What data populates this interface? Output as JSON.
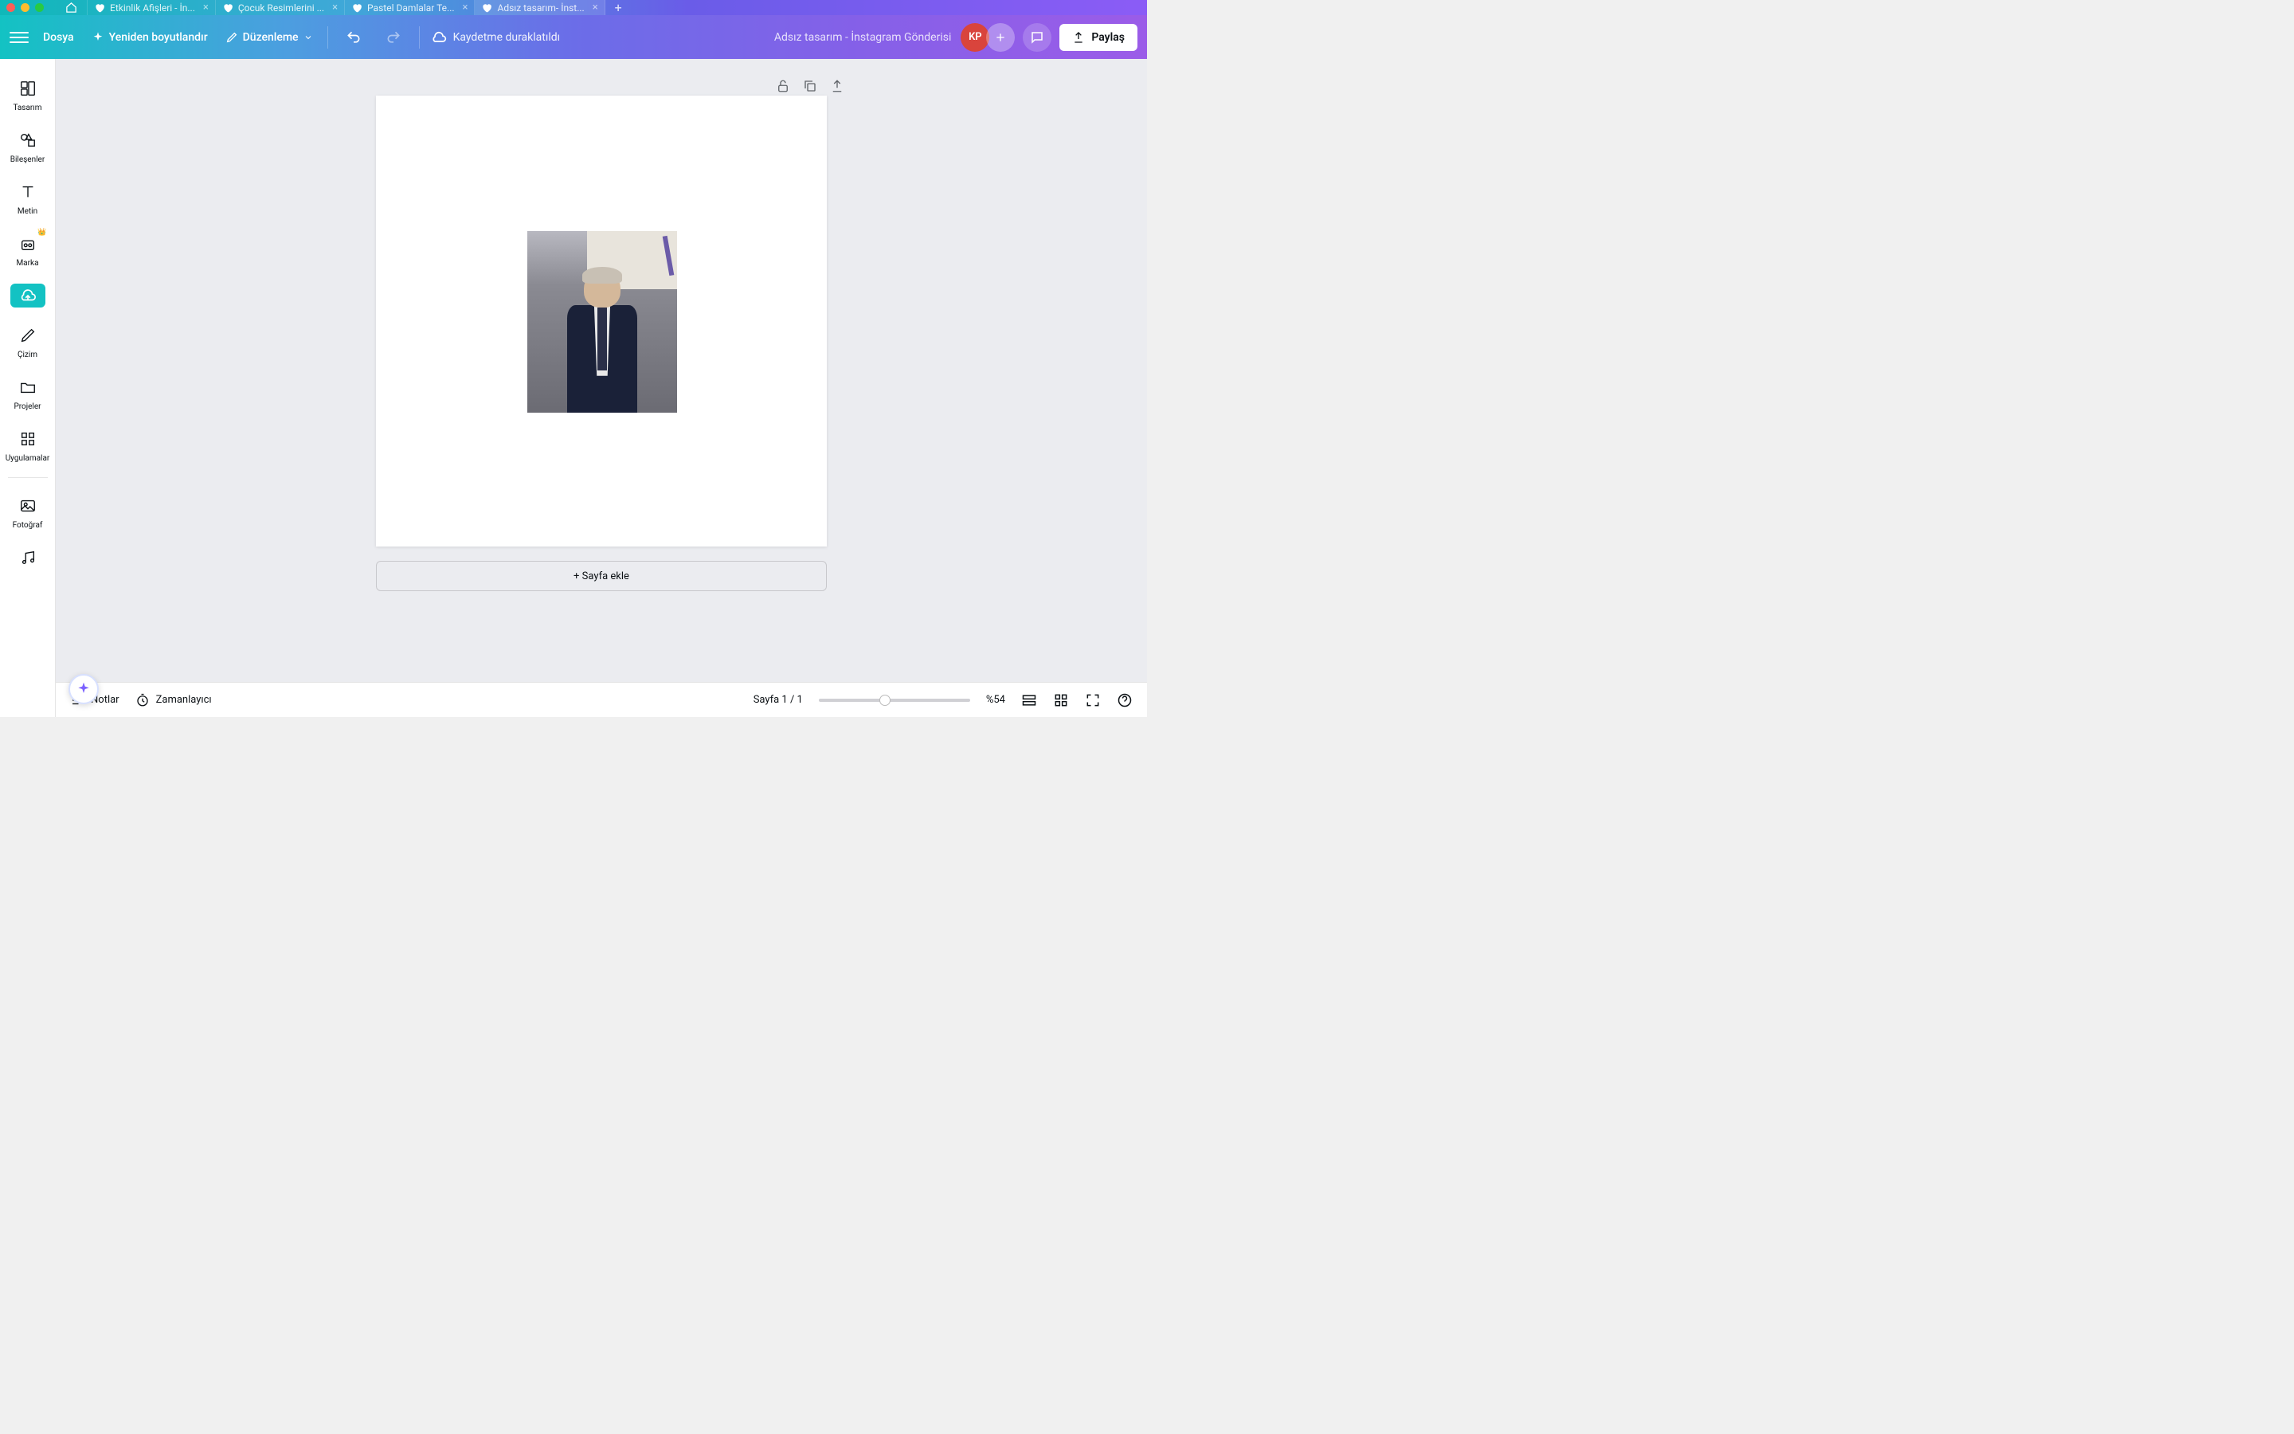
{
  "tabs": [
    {
      "label": "Etkinlik Afişleri - İn..."
    },
    {
      "label": "Çocuk Resimlerini ..."
    },
    {
      "label": "Pastel Damlalar Te..."
    },
    {
      "label": "Adsız tasarım- İnst..."
    }
  ],
  "toolbar": {
    "file_label": "Dosya",
    "resize_label": "Yeniden boyutlandır",
    "edit_label": "Düzenleme",
    "save_status": "Kaydetme duraklatıldı",
    "design_title": "Adsız tasarım - İnstagram Gönderisi",
    "share_label": "Paylaş",
    "avatar_initials": "KP"
  },
  "sidebar": {
    "items": {
      "design": "Tasarım",
      "elements": "Bileşenler",
      "text": "Metin",
      "brand": "Marka",
      "draw": "Çizim",
      "projects": "Projeler",
      "apps": "Uygulamalar",
      "photo": "Fotoğraf"
    }
  },
  "canvas": {
    "add_page_label": "+ Sayfa ekle"
  },
  "bottombar": {
    "notes_label": "Notlar",
    "timer_label": "Zamanlayıcı",
    "page_indicator": "Sayfa 1 / 1",
    "zoom_label": "%54"
  }
}
